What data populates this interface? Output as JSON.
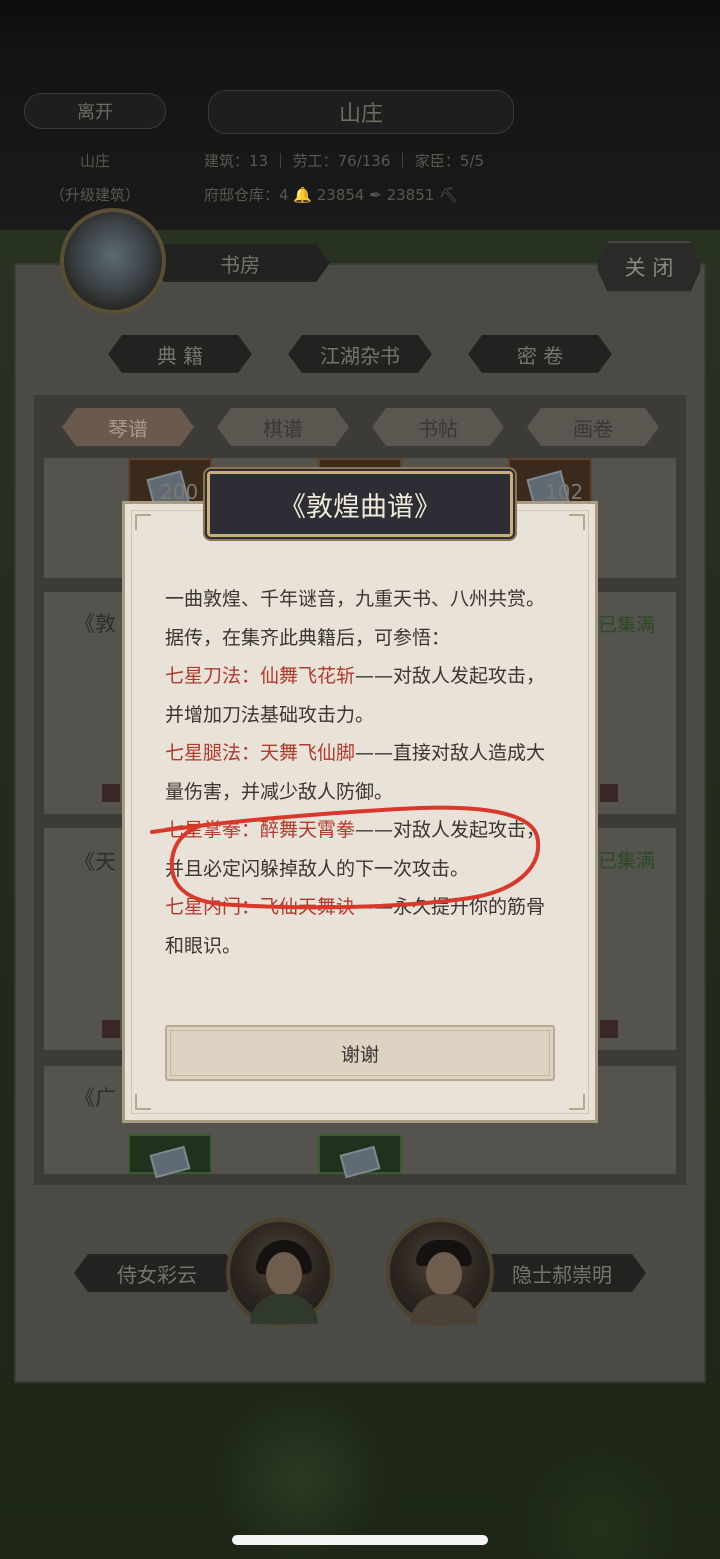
{
  "header": {
    "left_button": "离开",
    "title": "山庄",
    "stat_row1_left": "山庄",
    "stats_row1": "建筑：13 ｜ 劳工：76/136 ｜ 家臣：5/5",
    "stat_row2_left": "（升级建筑）",
    "stats_row2": "府邸仓库：4 🔔 23854 ✒ 23851 ⛏"
  },
  "panel": {
    "building_name": "书房",
    "close_label": "关 闭",
    "categories": [
      "典 籍",
      "江湖杂书",
      "密 卷"
    ],
    "subtabs": [
      "琴谱",
      "棋谱",
      "书帖",
      "画卷"
    ],
    "book_counts": [
      "200",
      "102"
    ],
    "cards": [
      {
        "title": "《敦",
        "status": "已集满"
      },
      {
        "title": "《天",
        "status": "已集满"
      },
      {
        "title": "《广",
        "status": ""
      }
    ],
    "npc_left": "侍女彩云",
    "npc_right": "隐士郝崇明"
  },
  "dialog": {
    "title": "《敦煌曲谱》",
    "intro": "一曲敦煌、千年谜音，九重天书、八州共赏。",
    "lead": "据传，在集齐此典籍后，可参悟：",
    "skills": [
      {
        "name": "七星刀法：仙舞飞花斩",
        "desc": "——对敌人发起攻击，并增加刀法基础攻击力。"
      },
      {
        "name": "七星腿法：天舞飞仙脚",
        "desc": "——直接对敌人造成大量伤害，并减少敌人防御。"
      },
      {
        "name": "七星掌拳：醉舞天霄拳",
        "desc": "——对敌人发起攻击，并且必定闪躲掉敌人的下一次攻击。"
      },
      {
        "name": "七星内门：飞仙天舞诀",
        "desc": "——永久提升你的筋骨和眼识。"
      }
    ],
    "button": "谢谢"
  },
  "colors": {
    "dialog_bg": "#e8e2d8",
    "skill_name": "#b23a2c",
    "annotation_stroke": "#d9382a",
    "title_bg": "#2c2d35"
  }
}
